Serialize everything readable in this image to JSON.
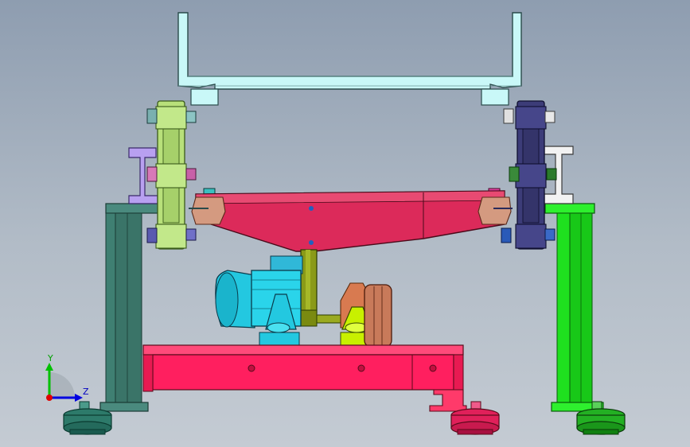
{
  "viewport": {
    "background_top": "#8e9db0",
    "background_bottom": "#c4cbd3"
  },
  "triad": {
    "y_label": "Y",
    "z_label": "Z",
    "y_color": "#00c000",
    "z_color": "#0000e0",
    "x_color": "#e00000"
  },
  "parts": {
    "top_frame": {
      "color": "#bff5f5",
      "icon": "channel-frame-icon"
    },
    "left_bracket": {
      "color": "#b8a0f0"
    },
    "right_bracket": {
      "color": "#f0f0f0"
    },
    "left_hanger": {
      "color": "#b8e07a"
    },
    "right_hanger": {
      "color": "#3c3c78"
    },
    "hopper": {
      "color": "#dc2a5a"
    },
    "hopper_ear": {
      "color": "#d49a80"
    },
    "left_column": {
      "color": "#3f7f72"
    },
    "right_column": {
      "color": "#1fe01f"
    },
    "base_frame": {
      "color": "#ff1f5f"
    },
    "motor": {
      "color": "#23c8e0"
    },
    "shaft_pipe": {
      "color": "#7a8a10"
    },
    "pump_housing": {
      "color": "#c8f000"
    },
    "pulley": {
      "color": "#c87a5a"
    },
    "foot_left": {
      "color": "#2d7a6a"
    },
    "foot_middle": {
      "color": "#e0205a"
    },
    "foot_right": {
      "color": "#23b023"
    }
  }
}
